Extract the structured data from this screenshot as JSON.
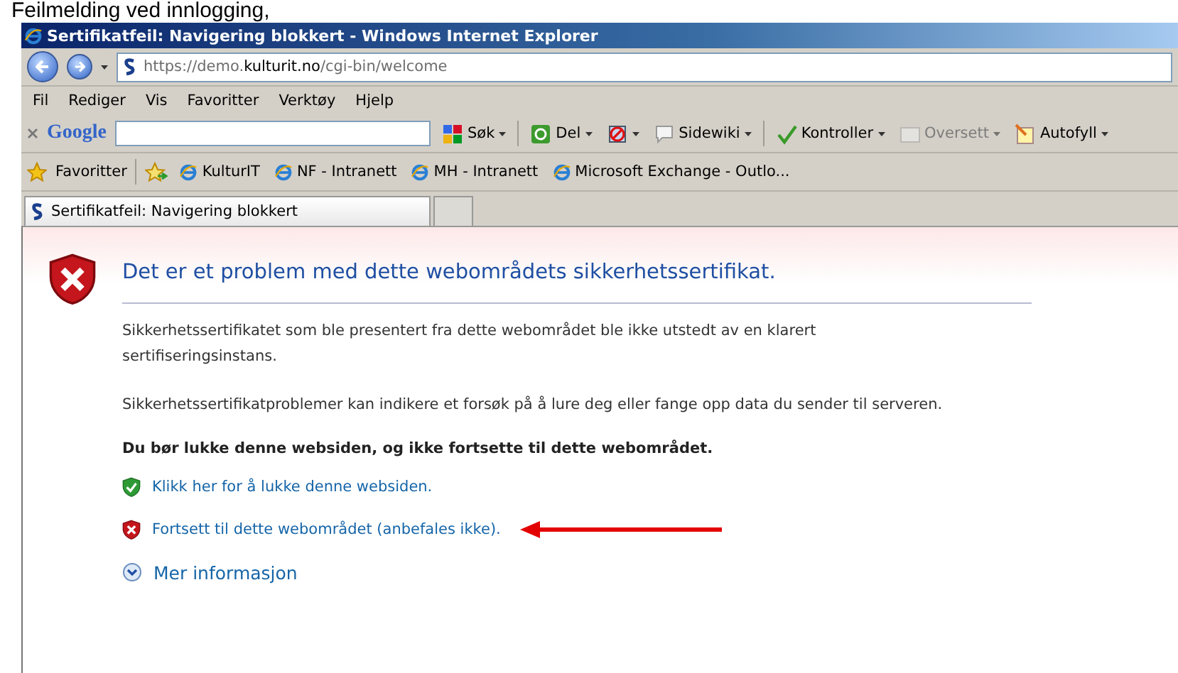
{
  "caption": "Feilmelding ved innlogging,",
  "window": {
    "title": "Sertifikatfeil: Navigering blokkert - Windows Internet Explorer"
  },
  "address": {
    "prefix": "https://demo.",
    "domain": "kulturit.no",
    "path": "/cgi-bin/welcome"
  },
  "menu": [
    "Fil",
    "Rediger",
    "Vis",
    "Favoritter",
    "Verktøy",
    "Hjelp"
  ],
  "google_toolbar": {
    "brand": "Google",
    "items": [
      {
        "kind": "search",
        "label": "Søk",
        "disabled": false
      },
      {
        "kind": "share",
        "label": "Del",
        "disabled": false
      },
      {
        "kind": "blocker",
        "disabled": false
      },
      {
        "kind": "sidewiki",
        "label": "Sidewiki",
        "disabled": false
      },
      {
        "kind": "spell",
        "label": "Kontroller",
        "disabled": false
      },
      {
        "kind": "translate",
        "label": "Oversett",
        "disabled": true
      },
      {
        "kind": "autofill",
        "label": "Autofyll",
        "disabled": false
      }
    ]
  },
  "favorites": {
    "label": "Favoritter",
    "links": [
      "KulturIT",
      "NF - Intranett",
      "MH - Intranett",
      "Microsoft Exchange - Outlo..."
    ]
  },
  "tabs": [
    {
      "label": "Sertifikatfeil: Navigering blokkert",
      "selected": true
    }
  ],
  "page": {
    "heading": "Det er et problem med dette webområdets sikkerhetssertifikat.",
    "paragraphs": [
      "Sikkerhetssertifikatet som ble presentert fra dette webområdet ble ikke utstedt av en klarert sertifiseringsinstans.",
      "Sikkerhetssertifikatproblemer kan indikere et forsøk på å lure deg eller fange opp data du sender til serveren."
    ],
    "warning": "Du bør lukke denne websiden, og ikke fortsette til dette webområdet.",
    "links": [
      {
        "kind": "safe",
        "label": "Klikk her for å lukke denne websiden.",
        "annotated": false
      },
      {
        "kind": "unsafe",
        "label": "Fortsett til dette webområdet (anbefales ikke).",
        "annotated": true
      }
    ],
    "more_info": "Mer informasjon"
  }
}
